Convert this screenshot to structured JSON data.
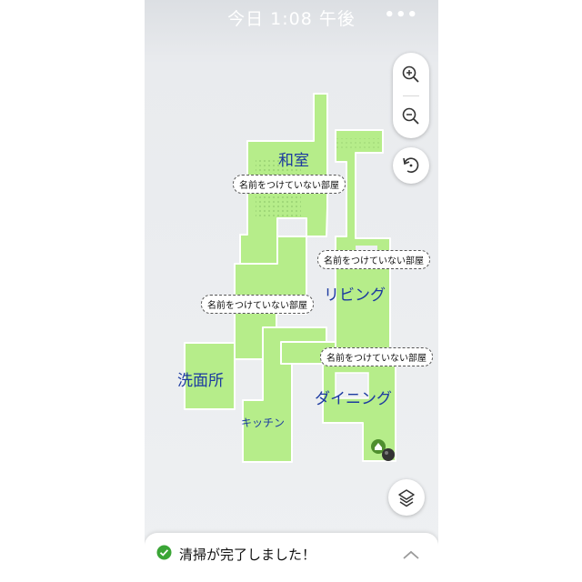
{
  "status_bar": {
    "title": "今日 1:08 午後",
    "more_icon": "more-icon"
  },
  "map": {
    "floor_color": "#b6ed8a",
    "rooms": [
      {
        "id": "washitsu",
        "label": "和室"
      },
      {
        "id": "living",
        "label": "リビング"
      },
      {
        "id": "senmenjo",
        "label": "洗面所"
      },
      {
        "id": "dining",
        "label": "ダイニング"
      },
      {
        "id": "kitchen",
        "label": "キッチン"
      }
    ],
    "unnamed_tags": [
      "名前をつけていない部屋",
      "名前をつけていない部屋",
      "名前をつけていない部屋",
      "名前をつけていない部屋"
    ],
    "dock_icon": "home-icon",
    "robot_icon": "robot-icon"
  },
  "controls": {
    "zoom_in_icon": "zoom-in-icon",
    "zoom_out_icon": "zoom-out-icon",
    "rotate_icon": "rotate-icon",
    "layers_icon": "layers-icon"
  },
  "bottom_sheet": {
    "message": "清掃が完了しました！",
    "status_color": "#3aa536"
  }
}
